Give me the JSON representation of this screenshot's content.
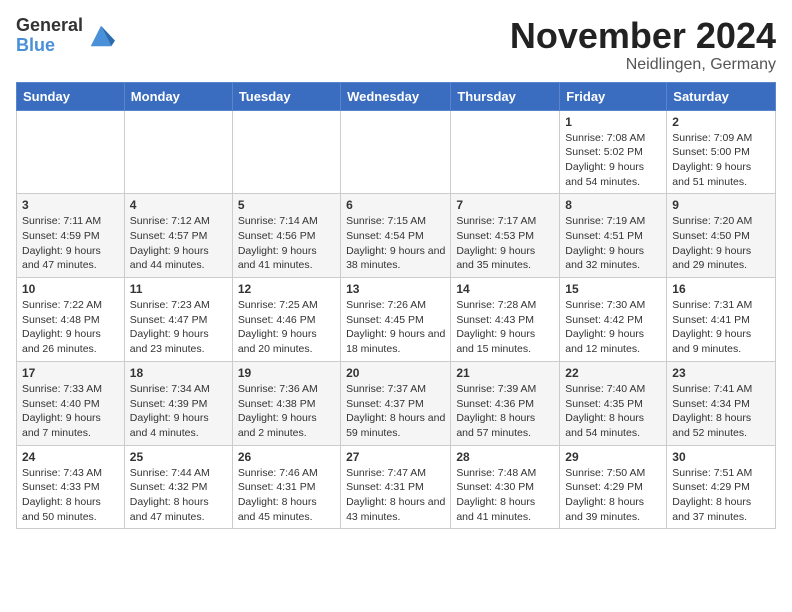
{
  "logo": {
    "general": "General",
    "blue": "Blue"
  },
  "title": "November 2024",
  "location": "Neidlingen, Germany",
  "weekdays": [
    "Sunday",
    "Monday",
    "Tuesday",
    "Wednesday",
    "Thursday",
    "Friday",
    "Saturday"
  ],
  "weeks": [
    [
      {
        "day": "",
        "info": ""
      },
      {
        "day": "",
        "info": ""
      },
      {
        "day": "",
        "info": ""
      },
      {
        "day": "",
        "info": ""
      },
      {
        "day": "",
        "info": ""
      },
      {
        "day": "1",
        "info": "Sunrise: 7:08 AM\nSunset: 5:02 PM\nDaylight: 9 hours and 54 minutes."
      },
      {
        "day": "2",
        "info": "Sunrise: 7:09 AM\nSunset: 5:00 PM\nDaylight: 9 hours and 51 minutes."
      }
    ],
    [
      {
        "day": "3",
        "info": "Sunrise: 7:11 AM\nSunset: 4:59 PM\nDaylight: 9 hours and 47 minutes."
      },
      {
        "day": "4",
        "info": "Sunrise: 7:12 AM\nSunset: 4:57 PM\nDaylight: 9 hours and 44 minutes."
      },
      {
        "day": "5",
        "info": "Sunrise: 7:14 AM\nSunset: 4:56 PM\nDaylight: 9 hours and 41 minutes."
      },
      {
        "day": "6",
        "info": "Sunrise: 7:15 AM\nSunset: 4:54 PM\nDaylight: 9 hours and 38 minutes."
      },
      {
        "day": "7",
        "info": "Sunrise: 7:17 AM\nSunset: 4:53 PM\nDaylight: 9 hours and 35 minutes."
      },
      {
        "day": "8",
        "info": "Sunrise: 7:19 AM\nSunset: 4:51 PM\nDaylight: 9 hours and 32 minutes."
      },
      {
        "day": "9",
        "info": "Sunrise: 7:20 AM\nSunset: 4:50 PM\nDaylight: 9 hours and 29 minutes."
      }
    ],
    [
      {
        "day": "10",
        "info": "Sunrise: 7:22 AM\nSunset: 4:48 PM\nDaylight: 9 hours and 26 minutes."
      },
      {
        "day": "11",
        "info": "Sunrise: 7:23 AM\nSunset: 4:47 PM\nDaylight: 9 hours and 23 minutes."
      },
      {
        "day": "12",
        "info": "Sunrise: 7:25 AM\nSunset: 4:46 PM\nDaylight: 9 hours and 20 minutes."
      },
      {
        "day": "13",
        "info": "Sunrise: 7:26 AM\nSunset: 4:45 PM\nDaylight: 9 hours and 18 minutes."
      },
      {
        "day": "14",
        "info": "Sunrise: 7:28 AM\nSunset: 4:43 PM\nDaylight: 9 hours and 15 minutes."
      },
      {
        "day": "15",
        "info": "Sunrise: 7:30 AM\nSunset: 4:42 PM\nDaylight: 9 hours and 12 minutes."
      },
      {
        "day": "16",
        "info": "Sunrise: 7:31 AM\nSunset: 4:41 PM\nDaylight: 9 hours and 9 minutes."
      }
    ],
    [
      {
        "day": "17",
        "info": "Sunrise: 7:33 AM\nSunset: 4:40 PM\nDaylight: 9 hours and 7 minutes."
      },
      {
        "day": "18",
        "info": "Sunrise: 7:34 AM\nSunset: 4:39 PM\nDaylight: 9 hours and 4 minutes."
      },
      {
        "day": "19",
        "info": "Sunrise: 7:36 AM\nSunset: 4:38 PM\nDaylight: 9 hours and 2 minutes."
      },
      {
        "day": "20",
        "info": "Sunrise: 7:37 AM\nSunset: 4:37 PM\nDaylight: 8 hours and 59 minutes."
      },
      {
        "day": "21",
        "info": "Sunrise: 7:39 AM\nSunset: 4:36 PM\nDaylight: 8 hours and 57 minutes."
      },
      {
        "day": "22",
        "info": "Sunrise: 7:40 AM\nSunset: 4:35 PM\nDaylight: 8 hours and 54 minutes."
      },
      {
        "day": "23",
        "info": "Sunrise: 7:41 AM\nSunset: 4:34 PM\nDaylight: 8 hours and 52 minutes."
      }
    ],
    [
      {
        "day": "24",
        "info": "Sunrise: 7:43 AM\nSunset: 4:33 PM\nDaylight: 8 hours and 50 minutes."
      },
      {
        "day": "25",
        "info": "Sunrise: 7:44 AM\nSunset: 4:32 PM\nDaylight: 8 hours and 47 minutes."
      },
      {
        "day": "26",
        "info": "Sunrise: 7:46 AM\nSunset: 4:31 PM\nDaylight: 8 hours and 45 minutes."
      },
      {
        "day": "27",
        "info": "Sunrise: 7:47 AM\nSunset: 4:31 PM\nDaylight: 8 hours and 43 minutes."
      },
      {
        "day": "28",
        "info": "Sunrise: 7:48 AM\nSunset: 4:30 PM\nDaylight: 8 hours and 41 minutes."
      },
      {
        "day": "29",
        "info": "Sunrise: 7:50 AM\nSunset: 4:29 PM\nDaylight: 8 hours and 39 minutes."
      },
      {
        "day": "30",
        "info": "Sunrise: 7:51 AM\nSunset: 4:29 PM\nDaylight: 8 hours and 37 minutes."
      }
    ]
  ]
}
